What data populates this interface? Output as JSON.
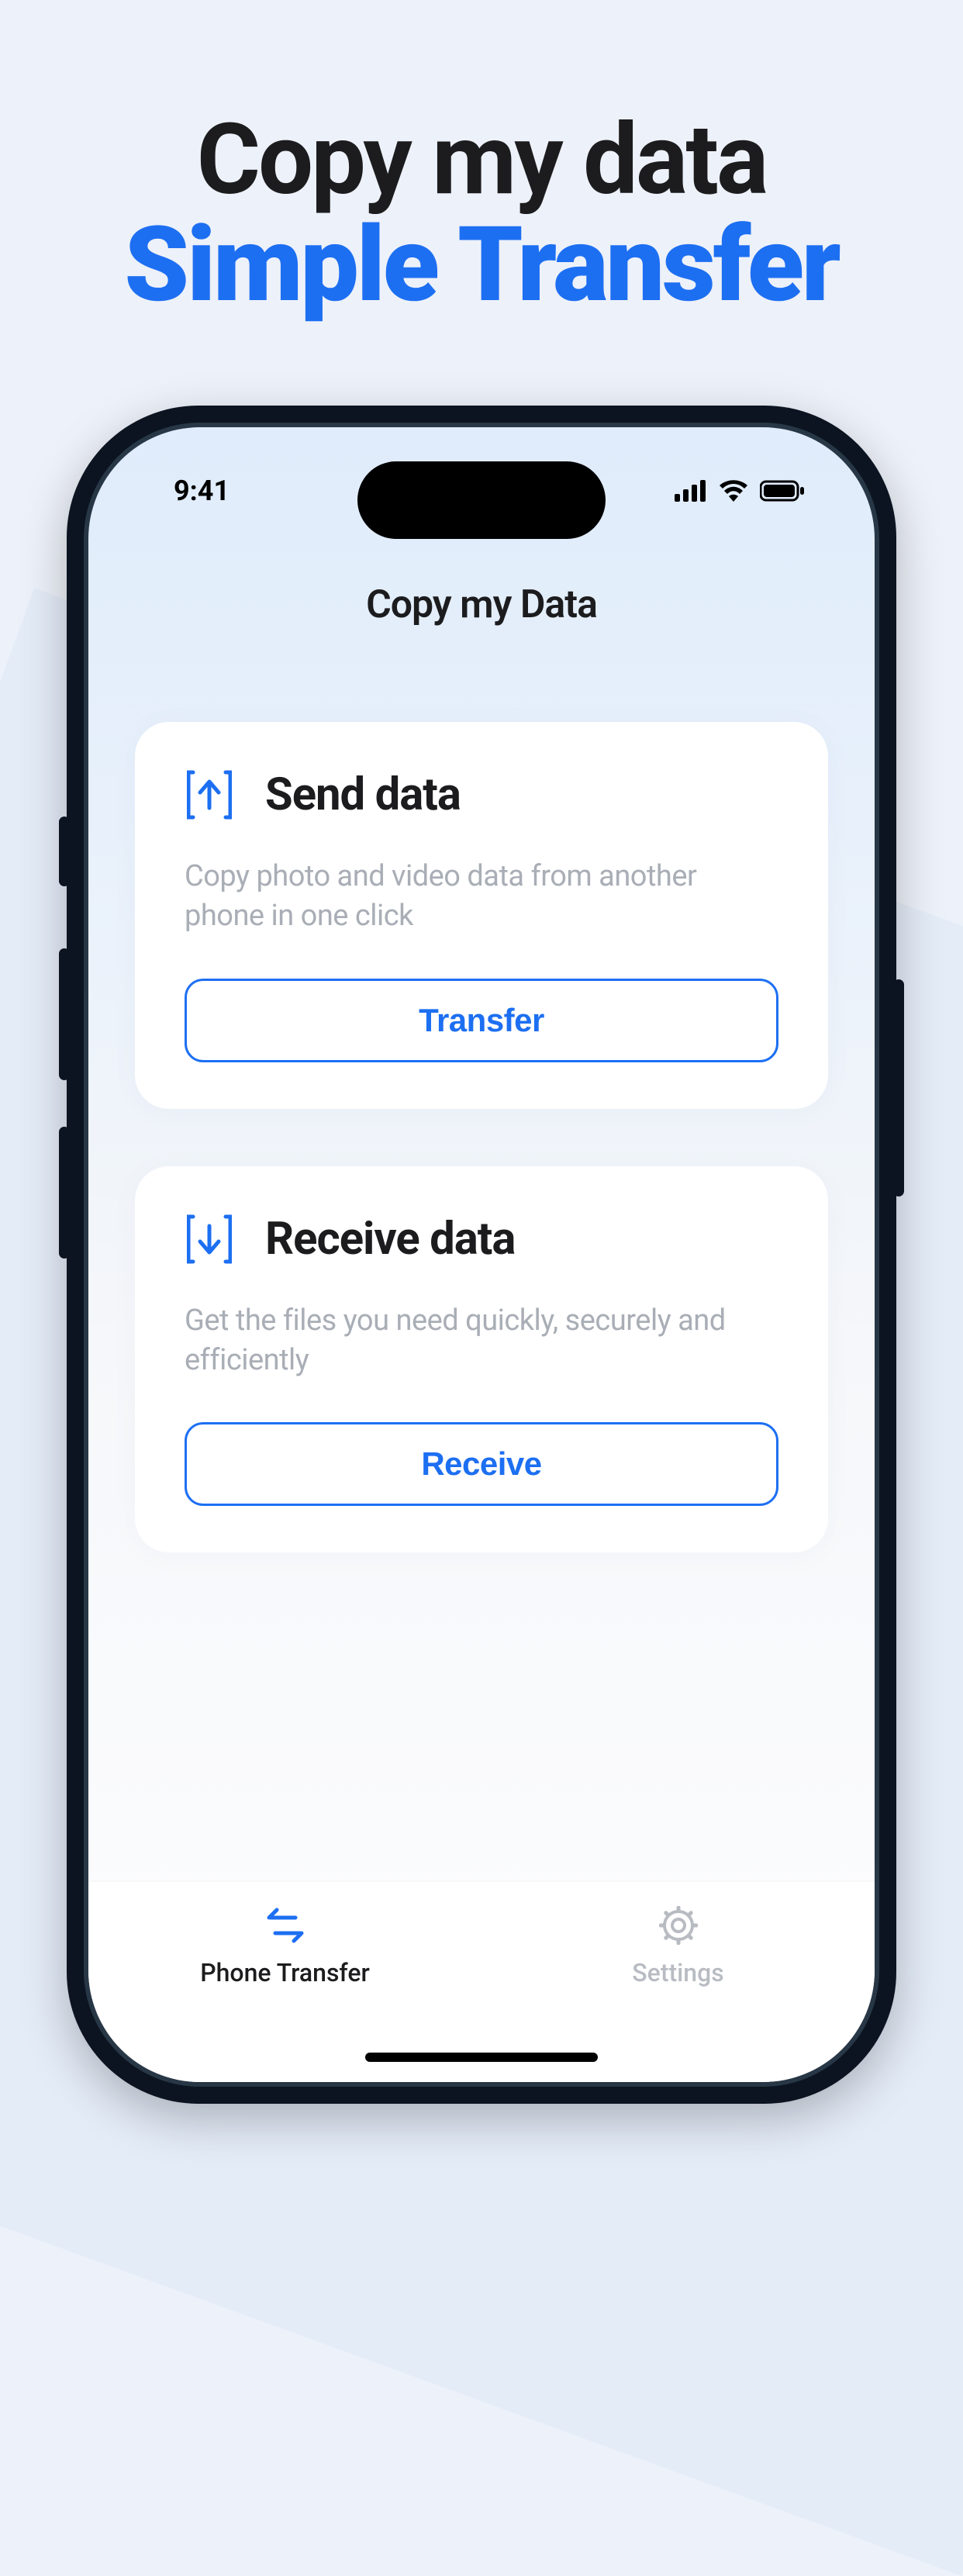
{
  "headline": {
    "line1": "Copy my data",
    "line2": "Simple Transfer"
  },
  "status": {
    "time": "9:41"
  },
  "app": {
    "title": "Copy my Data"
  },
  "cards": {
    "send": {
      "title": "Send data",
      "desc": "Copy photo and video data from another phone in one click",
      "button": "Transfer"
    },
    "receive": {
      "title": "Receive data",
      "desc": "Get the files you need quickly, securely and efficiently",
      "button": "Receive"
    }
  },
  "tabs": {
    "transfer": "Phone Transfer",
    "settings": "Settings"
  },
  "colors": {
    "accent": "#1D6FF2"
  }
}
